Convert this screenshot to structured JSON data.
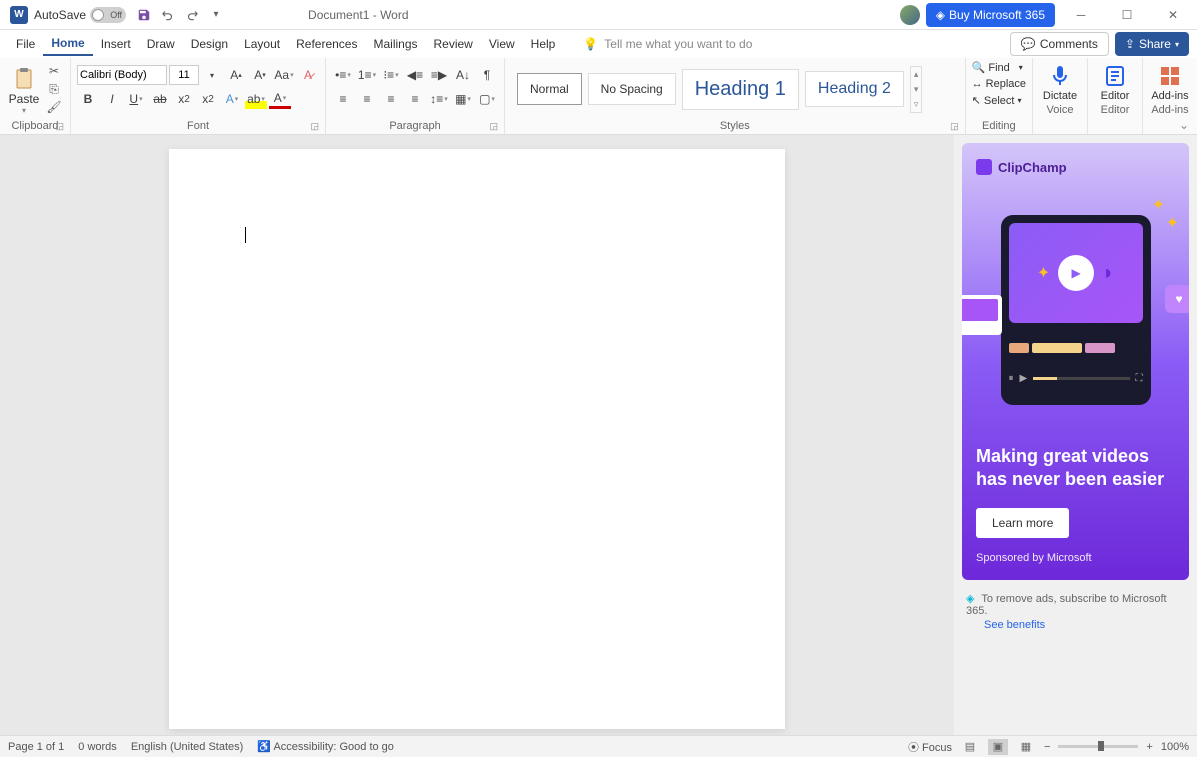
{
  "titlebar": {
    "autosave_label": "AutoSave",
    "autosave_state": "Off",
    "doc_title": "Document1  -  Word",
    "buy_label": "Buy Microsoft 365"
  },
  "menu": {
    "items": [
      "File",
      "Home",
      "Insert",
      "Draw",
      "Design",
      "Layout",
      "References",
      "Mailings",
      "Review",
      "View",
      "Help"
    ],
    "tellme_placeholder": "Tell me what you want to do",
    "comments": "Comments",
    "share": "Share"
  },
  "ribbon": {
    "clipboard": {
      "paste": "Paste",
      "label": "Clipboard"
    },
    "font": {
      "name": "Calibri (Body)",
      "size": "11",
      "label": "Font"
    },
    "paragraph": {
      "label": "Paragraph"
    },
    "styles": {
      "items": [
        "Normal",
        "No Spacing",
        "Heading 1",
        "Heading 2"
      ],
      "label": "Styles"
    },
    "editing": {
      "find": "Find",
      "replace": "Replace",
      "select": "Select",
      "label": "Editing"
    },
    "voice": {
      "dictate": "Dictate",
      "label": "Voice"
    },
    "editor": {
      "editor": "Editor",
      "label": "Editor"
    },
    "addins": {
      "addins": "Add-ins",
      "label": "Add-ins"
    }
  },
  "ad": {
    "brand": "ClipChamp",
    "heading": "Making great videos has never been easier",
    "cta": "Learn more",
    "sponsored": "Sponsored by Microsoft",
    "footer_text": "To remove ads, subscribe to Microsoft 365.",
    "footer_link": "See benefits"
  },
  "statusbar": {
    "page": "Page 1 of 1",
    "words": "0 words",
    "lang": "English (United States)",
    "accessibility": "Accessibility: Good to go",
    "focus": "Focus",
    "zoom": "100%"
  }
}
